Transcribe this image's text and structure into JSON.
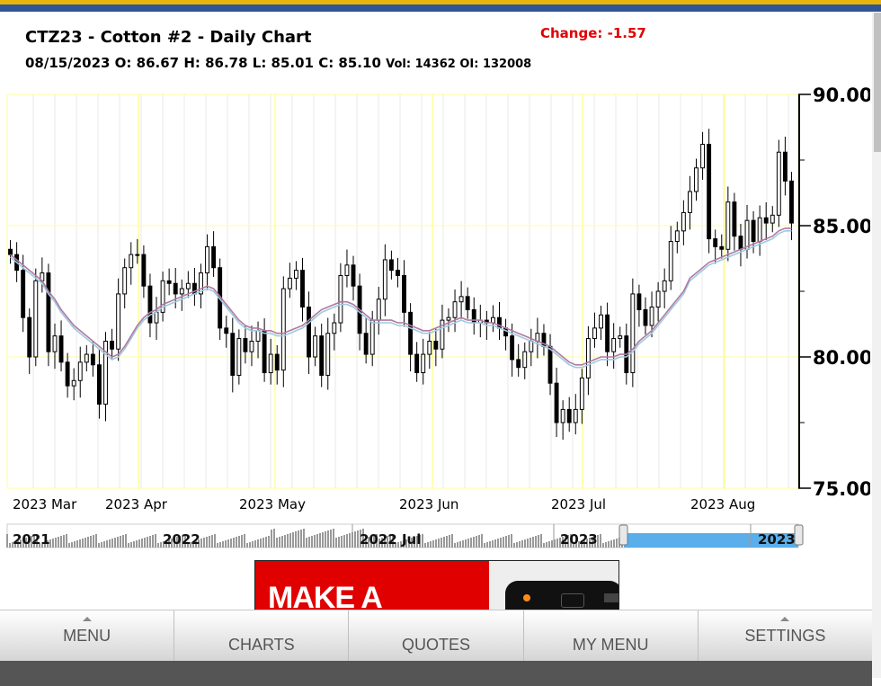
{
  "header": {
    "title": "CTZ23 - Cotton #2 - Daily Chart",
    "ohlc_main": "08/15/2023 O: 86.67 H: 86.78 L: 85.01 C: 85.10",
    "ohlc_extra": "Vol: 14362 OI: 132008",
    "change": "Change: -1.57"
  },
  "chart_data": {
    "type": "candlestick",
    "title": "CTZ23 - Cotton #2 - Daily Chart",
    "ylim": [
      75,
      90
    ],
    "y_ticks": [
      "90.00",
      "85.00",
      "80.00",
      "75.00"
    ],
    "x_tick_labels": [
      "2023 Mar",
      "2023 Apr",
      "2023 May",
      "2023 Jun",
      "2023 Jul",
      "2023 Aug"
    ],
    "grid": true,
    "closes": [
      83.9,
      83.3,
      81.5,
      80.0,
      82.9,
      83.2,
      80.2,
      80.8,
      79.8,
      78.9,
      79.1,
      79.8,
      80.1,
      79.7,
      78.2,
      80.6,
      80.3,
      82.4,
      83.4,
      83.9,
      83.9,
      82.7,
      81.3,
      81.7,
      82.9,
      82.8,
      82.4,
      82.6,
      82.8,
      82.4,
      83.2,
      84.2,
      83.4,
      81.1,
      80.9,
      79.3,
      80.7,
      80.2,
      80.6,
      81.0,
      79.4,
      80.1,
      79.5,
      82.6,
      83.0,
      83.3,
      81.9,
      80.0,
      80.8,
      79.3,
      80.9,
      81.3,
      83.1,
      83.5,
      82.7,
      80.9,
      80.1,
      81.4,
      82.2,
      83.7,
      83.3,
      83.1,
      81.7,
      80.1,
      79.4,
      80.1,
      80.6,
      80.3,
      81.4,
      81.5,
      82.1,
      82.3,
      81.8,
      81.3,
      81.4,
      81.3,
      81.5,
      81.1,
      80.8,
      79.9,
      79.6,
      80.2,
      80.6,
      80.9,
      80.4,
      79.0,
      77.5,
      78.0,
      77.5,
      78.0,
      79.2,
      80.7,
      81.1,
      81.6,
      80.2,
      80.7,
      80.8,
      79.4,
      82.4,
      81.8,
      81.2,
      81.9,
      82.5,
      82.9,
      84.4,
      84.8,
      85.5,
      86.3,
      87.2,
      88.1,
      84.5,
      84.2,
      84.1,
      85.9,
      84.6,
      84.1,
      85.2,
      84.4,
      85.3,
      85.1,
      85.4,
      87.8,
      86.7,
      85.1
    ],
    "ma1": [
      83.9,
      83.7,
      83.5,
      83.3,
      83.1,
      82.9,
      82.5,
      82.2,
      81.8,
      81.5,
      81.2,
      81.0,
      80.8,
      80.6,
      80.4,
      80.2,
      80.0,
      80.1,
      80.4,
      80.8,
      81.2,
      81.5,
      81.7,
      81.8,
      82.0,
      82.1,
      82.2,
      82.3,
      82.4,
      82.5,
      82.6,
      82.7,
      82.6,
      82.3,
      82.0,
      81.7,
      81.4,
      81.2,
      81.1,
      81.1,
      81.0,
      81.0,
      80.9,
      80.9,
      81.0,
      81.1,
      81.2,
      81.4,
      81.6,
      81.8,
      81.9,
      82.0,
      82.1,
      82.1,
      82.0,
      81.8,
      81.6,
      81.4,
      81.4,
      81.4,
      81.4,
      81.3,
      81.3,
      81.2,
      81.1,
      81.0,
      81.0,
      81.1,
      81.2,
      81.3,
      81.4,
      81.5,
      81.4,
      81.4,
      81.4,
      81.3,
      81.3,
      81.2,
      81.1,
      81.0,
      80.9,
      80.8,
      80.7,
      80.6,
      80.5,
      80.4,
      80.2,
      80.0,
      79.8,
      79.7,
      79.7,
      79.8,
      79.9,
      80.0,
      80.0,
      80.0,
      80.1,
      80.1,
      80.3,
      80.6,
      80.8,
      81.0,
      81.3,
      81.6,
      81.9,
      82.2,
      82.5,
      83.0,
      83.2,
      83.4,
      83.6,
      83.7,
      83.8,
      83.9,
      84.0,
      84.1,
      84.2,
      84.3,
      84.4,
      84.5,
      84.6,
      84.8,
      84.9,
      84.9
    ],
    "ma2": [
      83.8,
      83.6,
      83.4,
      83.2,
      83.0,
      82.8,
      82.4,
      82.1,
      81.7,
      81.4,
      81.1,
      80.9,
      80.7,
      80.5,
      80.3,
      80.1,
      79.9,
      80.0,
      80.3,
      80.7,
      81.1,
      81.4,
      81.6,
      81.7,
      81.9,
      82.0,
      82.1,
      82.2,
      82.3,
      82.4,
      82.5,
      82.6,
      82.5,
      82.2,
      81.9,
      81.6,
      81.3,
      81.1,
      81.0,
      81.0,
      80.9,
      80.9,
      80.8,
      80.8,
      80.9,
      81.0,
      81.1,
      81.3,
      81.5,
      81.7,
      81.8,
      81.9,
      82.0,
      82.0,
      81.9,
      81.7,
      81.5,
      81.3,
      81.3,
      81.3,
      81.3,
      81.2,
      81.2,
      81.1,
      81.0,
      80.9,
      80.9,
      81.0,
      81.1,
      81.2,
      81.3,
      81.4,
      81.3,
      81.3,
      81.3,
      81.2,
      81.2,
      81.1,
      81.0,
      80.9,
      80.8,
      80.7,
      80.6,
      80.5,
      80.4,
      80.3,
      80.1,
      79.9,
      79.7,
      79.6,
      79.6,
      79.7,
      79.8,
      79.9,
      79.9,
      79.9,
      80.0,
      80.0,
      80.2,
      80.5,
      80.7,
      80.9,
      81.2,
      81.5,
      81.8,
      82.1,
      82.4,
      82.9,
      83.1,
      83.3,
      83.5,
      83.6,
      83.7,
      83.8,
      83.9,
      84.0,
      84.1,
      84.2,
      84.3,
      84.4,
      84.5,
      84.7,
      84.8,
      84.8
    ]
  },
  "timeline": {
    "labels": [
      "2021",
      "2022",
      "2022 Jul",
      "2023",
      "2023"
    ]
  },
  "ad": {
    "text": "MAKE A"
  },
  "nav": {
    "menu": "MENU",
    "charts": "CHARTS",
    "quotes": "QUOTES",
    "my_menu": "MY MENU",
    "settings": "SETTINGS"
  },
  "colors": {
    "grid_major": "#ffff99",
    "grid_minor": "#e8e8e8",
    "ma1": "#b07aa1",
    "ma2": "#9ecae1",
    "change": "#e00000",
    "navigator_fill": "#5aaeea"
  }
}
